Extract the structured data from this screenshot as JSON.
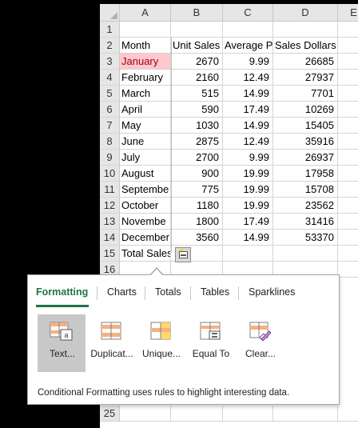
{
  "columns": [
    "A",
    "B",
    "C",
    "D",
    "E"
  ],
  "rows": [
    {
      "num": "1",
      "a": "",
      "b": "",
      "c": "",
      "d": ""
    },
    {
      "num": "2",
      "a": "Month",
      "b": "Unit Sales",
      "c": "Average P",
      "d": "Sales Dollars"
    },
    {
      "num": "3",
      "a": "January",
      "b": "2670",
      "c": "9.99",
      "d": "26685"
    },
    {
      "num": "4",
      "a": "February",
      "b": "2160",
      "c": "12.49",
      "d": "27937"
    },
    {
      "num": "5",
      "a": "March",
      "b": "515",
      "c": "14.99",
      "d": "7701"
    },
    {
      "num": "6",
      "a": "April",
      "b": "590",
      "c": "17.49",
      "d": "10269"
    },
    {
      "num": "7",
      "a": "May",
      "b": "1030",
      "c": "14.99",
      "d": "15405"
    },
    {
      "num": "8",
      "a": "June",
      "b": "2875",
      "c": "12.49",
      "d": "35916"
    },
    {
      "num": "9",
      "a": "July",
      "b": "2700",
      "c": "9.99",
      "d": "26937"
    },
    {
      "num": "10",
      "a": "August",
      "b": "900",
      "c": "19.99",
      "d": "17958"
    },
    {
      "num": "11",
      "a": "Septembe",
      "b": "775",
      "c": "19.99",
      "d": "15708"
    },
    {
      "num": "12",
      "a": "October",
      "b": "1180",
      "c": "19.99",
      "d": "23562"
    },
    {
      "num": "13",
      "a": "Novembe",
      "b": "1800",
      "c": "17.49",
      "d": "31416"
    },
    {
      "num": "14",
      "a": "December",
      "b": "3560",
      "c": "14.99",
      "d": "53370"
    },
    {
      "num": "15",
      "a": "Total Sales",
      "b": "",
      "c": "",
      "d": ""
    },
    {
      "num": "16",
      "a": "",
      "b": "",
      "c": "",
      "d": ""
    },
    {
      "num": "25",
      "a": "",
      "b": "",
      "c": "",
      "d": ""
    }
  ],
  "highlighted_cell": "A3",
  "highlight_color": "#ffc7ce",
  "quick_analysis": {
    "tabs": [
      {
        "label": "Formatting",
        "active": true
      },
      {
        "label": "Charts",
        "active": false
      },
      {
        "label": "Totals",
        "active": false
      },
      {
        "label": "Tables",
        "active": false
      },
      {
        "label": "Sparklines",
        "active": false
      }
    ],
    "gallery": [
      {
        "label": "Text...",
        "icon": "text-contains-icon",
        "selected": true
      },
      {
        "label": "Duplicat...",
        "icon": "duplicate-values-icon",
        "selected": false
      },
      {
        "label": "Unique...",
        "icon": "unique-values-icon",
        "selected": false
      },
      {
        "label": "Equal To",
        "icon": "equal-to-icon",
        "selected": false
      },
      {
        "label": "Clear...",
        "icon": "clear-format-icon",
        "selected": false
      }
    ],
    "description": "Conditional Formatting uses rules to highlight interesting data."
  },
  "accent_color": "#217346"
}
